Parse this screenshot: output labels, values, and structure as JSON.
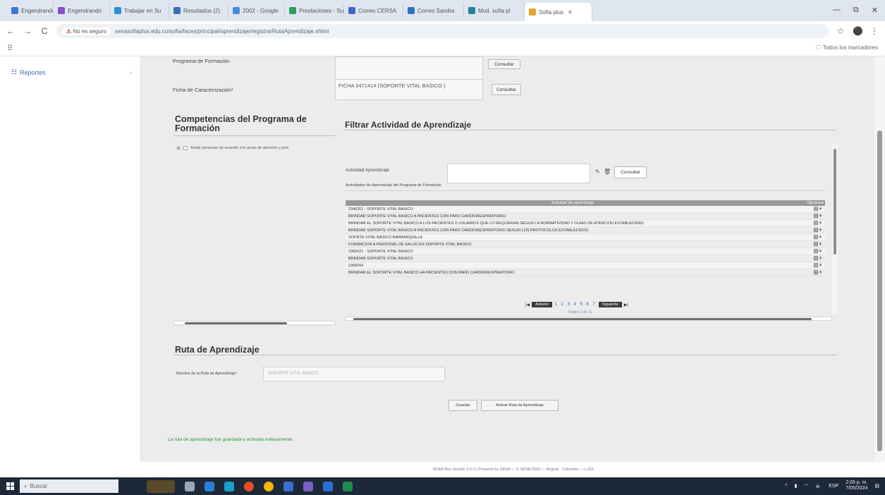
{
  "browser": {
    "tabs": [
      {
        "label": "Engendrando Su",
        "color": "#3c78d8"
      },
      {
        "label": "Engendrando",
        "color": "#8a4fc7"
      },
      {
        "label": "Trabajar en Su",
        "color": "#2a8fd8"
      },
      {
        "label": "Resultados (2)",
        "color": "#3d6fb6"
      },
      {
        "label": "2002 - Google",
        "color": "#4a8bd8"
      },
      {
        "label": "Prestaciones - Su",
        "color": "#2e9f5b"
      },
      {
        "label": "Correo CERSA",
        "color": "#3a6bc2"
      },
      {
        "label": "Correo Sandra",
        "color": "#2f6fc2"
      },
      {
        "label": "Mod. sofia pl",
        "color": "#2a7f9f"
      },
      {
        "label": "Sofia plus",
        "color": "#e4a52b"
      }
    ],
    "window_controls": [
      "—",
      "⧉",
      "✕"
    ],
    "nav": {
      "back": "←",
      "forward": "→",
      "reload": "C"
    },
    "address": {
      "security_label": "No es seguro",
      "url": "senasofiaplus.edu.co/sofia/faces/principal/aprendizaje/registrarRutaAprendizaje.xhtml"
    },
    "star": "☆",
    "profile": "⚫",
    "menu": "⋮",
    "apps": "⠿",
    "bookmarks_right": "Todos los marcadores"
  },
  "sidebar": {
    "items": [
      {
        "label": "Reportes",
        "chevron": "›"
      }
    ]
  },
  "form": {
    "programa_label": "Programa de Formación",
    "programa_button": "Consultar",
    "ficha_label": "Ficha de Caracterización*",
    "ficha_value": "FICHA 3471414 (SOPORTE VITAL BASICO )",
    "ficha_button": "Consultar"
  },
  "competencias": {
    "title": "Competencias del Programa de Formación",
    "item": "Asistir personas de acuerdo con guías de atención y prot"
  },
  "filtrar": {
    "title": "Filtrar Actividad de Aprendizaje",
    "actividad_label": "Actividad Aprendizaje",
    "consultar_button": "Consultar",
    "table_caption": "Actividades de Aprendizaje del Programa de Formación",
    "columns": [
      "Actividad de aprendizaje",
      "Opciones"
    ],
    "rows": [
      "2346201 - SOPORTE VITAL BASICO",
      "BRINDAR SOPORTE VITAL BÁSICO A PACIENTES CON PARO CARDIORESPIRATORIO.",
      "BRINDAR EL SOPORTE VITAL BÁSICO A LOS PACIENTES O USUARIOS QUE LO REQUIERAN SEGÚN LA NORMATIVIDAD Y GUÍAS DE ATENCIÓN ESTABLECIDAS",
      "BRINDAR SOPORTE VITAL BASICO A PACIENTES CON PARO CARDIORESPIRATORIO SEGÚN LOS PROTOCOLOS ESTABLECIDOS",
      "SOPRTE VITAL BASICO BARRANQUILLA",
      "FORMACIÓN A PERSONAL DE SALUD EN SOPORTE VITAL BASICO",
      "2360021 - SOPORTE VITAL BASICO",
      "BRINDAR SOPORTE VITAL BASICO",
      "2368266",
      "BRINDAR EL SOPORTE VITAL BASICO HA PACIENTES CON PARO CARDIORESPIRATORIO."
    ],
    "row_action_icon": "⊞+",
    "pager": {
      "first": "|◀",
      "prev": "Anterior",
      "pages": "1 2 3 4 5 6 7",
      "next": "Siguiente",
      "last": "▶|",
      "info": "Página 1 de 11"
    }
  },
  "ruta": {
    "title": "Ruta de Aprendizaje",
    "nombre_label": "Nombre de la Ruta de Aprendizaje*",
    "nombre_value": "SOPORTE VITAL BASICO",
    "guardar_button": "Guardar",
    "activar_button": "Activar Ruta de Aprendizaje",
    "success_message": "La ruta de aprendizaje fue guardada y activada exitosamente."
  },
  "footer": {
    "text": "SENA Plus Versión 5.5.0 | Powered by SENA — © SENA 2019 — Bogotá · Colombia — v.162"
  },
  "taskbar": {
    "search_placeholder": "Buscar",
    "lang": "ESP",
    "time": "2:05 p. m.",
    "date": "7/05/2024"
  }
}
